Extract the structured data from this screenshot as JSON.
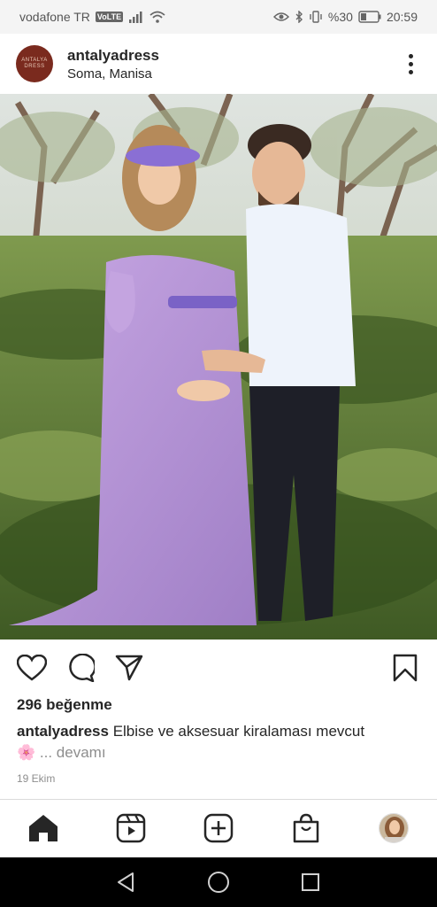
{
  "status_bar": {
    "carrier": "vodafone TR",
    "volte": "VoLTE",
    "battery": "%30",
    "time": "20:59",
    "icons": [
      "signal-icon",
      "wifi-icon",
      "eye-icon",
      "bluetooth-icon",
      "vibrate-icon",
      "battery-icon"
    ]
  },
  "post": {
    "avatar_text": "ANTALYA DRESS",
    "username": "antalyadress",
    "location": "Soma, Manisa",
    "likes": "296 beğenme",
    "caption_user": "antalyadress",
    "caption_text": "Elbise ve aksesuar kiralaması mevcut",
    "caption_emoji": "🌸",
    "more_label": "... devamı",
    "date": "19 Ekim"
  },
  "actions": [
    "heart-icon",
    "comment-icon",
    "share-icon",
    "bookmark-icon"
  ],
  "tabs": [
    "home-icon",
    "reels-icon",
    "create-icon",
    "shop-icon",
    "profile-avatar"
  ],
  "nav": [
    "back-icon",
    "home-circle-icon",
    "recents-icon"
  ]
}
